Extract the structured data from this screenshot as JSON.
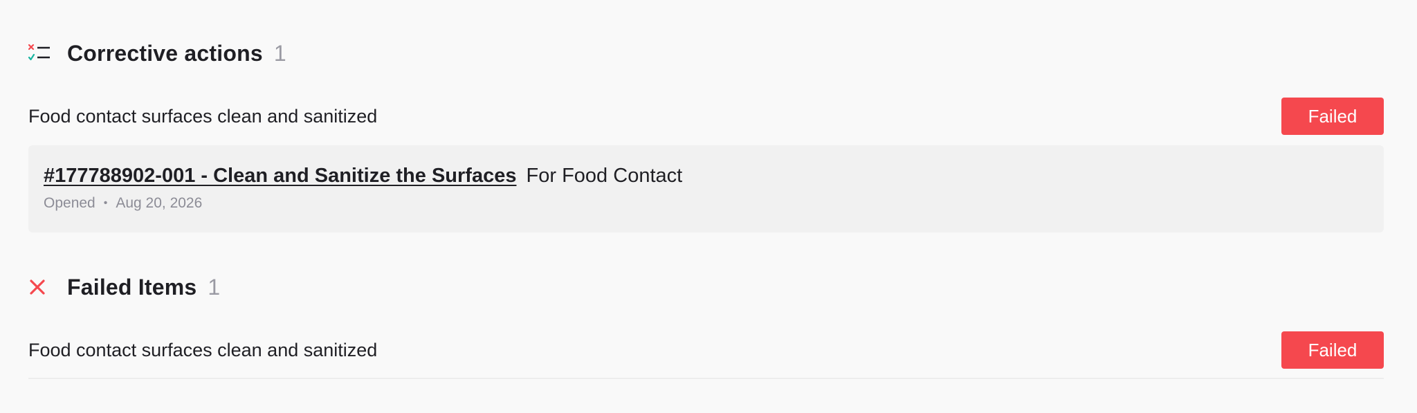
{
  "corrective_actions": {
    "title": "Corrective actions",
    "count": "1",
    "item": {
      "label": "Food contact surfaces clean and sanitized",
      "status": "Failed"
    },
    "action": {
      "link_text": "#177788902-001 - Clean and Sanitize the Surfaces",
      "rest_text": "For Food Contact",
      "state": "Opened",
      "date": "Aug 20, 2026"
    }
  },
  "failed_items": {
    "title": "Failed Items",
    "count": "1",
    "item": {
      "label": "Food contact surfaces clean and sanitized",
      "status": "Failed"
    }
  },
  "colors": {
    "failed": "#f5484e",
    "check": "#18b4a0",
    "card_background": "#f1f1f1"
  },
  "icons": {
    "corrective_actions": "checklist-icon",
    "failed_items": "close-icon"
  }
}
